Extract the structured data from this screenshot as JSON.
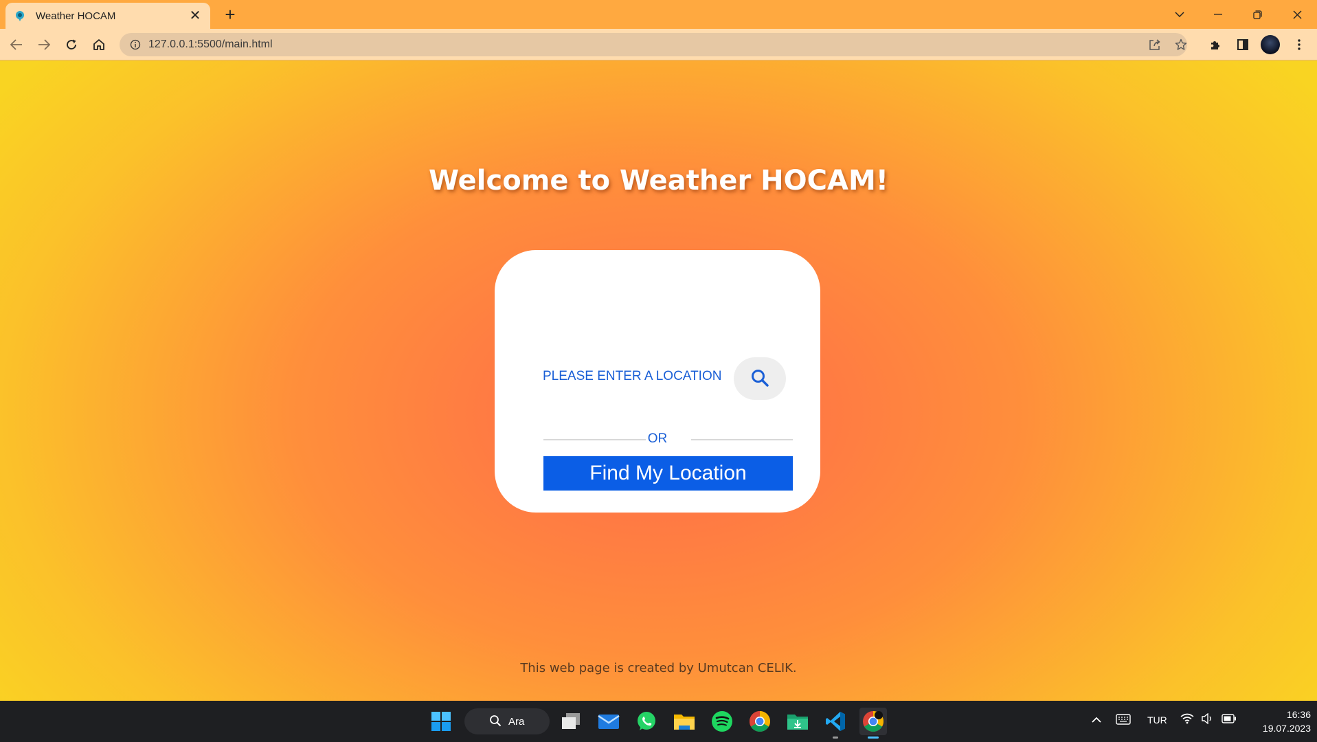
{
  "browser": {
    "tab_title": "Weather HOCAM",
    "tab_close_glyph": "✕",
    "new_tab_glyph": "+",
    "url": "127.0.0.1:5500/main.html",
    "icons": [
      "back-icon",
      "forward-icon",
      "reload-icon",
      "home-icon",
      "info-icon",
      "share-icon",
      "star-icon",
      "extensions-icon",
      "side-panel-icon",
      "profile-avatar",
      "menu-icon"
    ]
  },
  "page": {
    "heading": "Welcome to Weather HOCAM!",
    "search_placeholder": "PLEASE ENTER A LOCATION",
    "or_text": "OR",
    "find_button_label": "Find My Location",
    "footer_text": "This web page is created by Umutcan CELIK.",
    "colors": {
      "accent_blue": "#0b5ee6",
      "text_blue": "#1a5fd6",
      "gradient_center": "#ff6a4a",
      "gradient_edge": "#f9d422"
    }
  },
  "taskbar": {
    "search_label": "Ara",
    "apps": [
      "start-icon",
      "task-view-icon",
      "mail-icon",
      "whatsapp-icon",
      "file-explorer-icon",
      "spotify-icon",
      "chrome-icon",
      "downloads-icon",
      "vscode-icon",
      "chrome-active-icon"
    ],
    "language": "TUR",
    "time": "16:36",
    "date": "19.07.2023"
  }
}
